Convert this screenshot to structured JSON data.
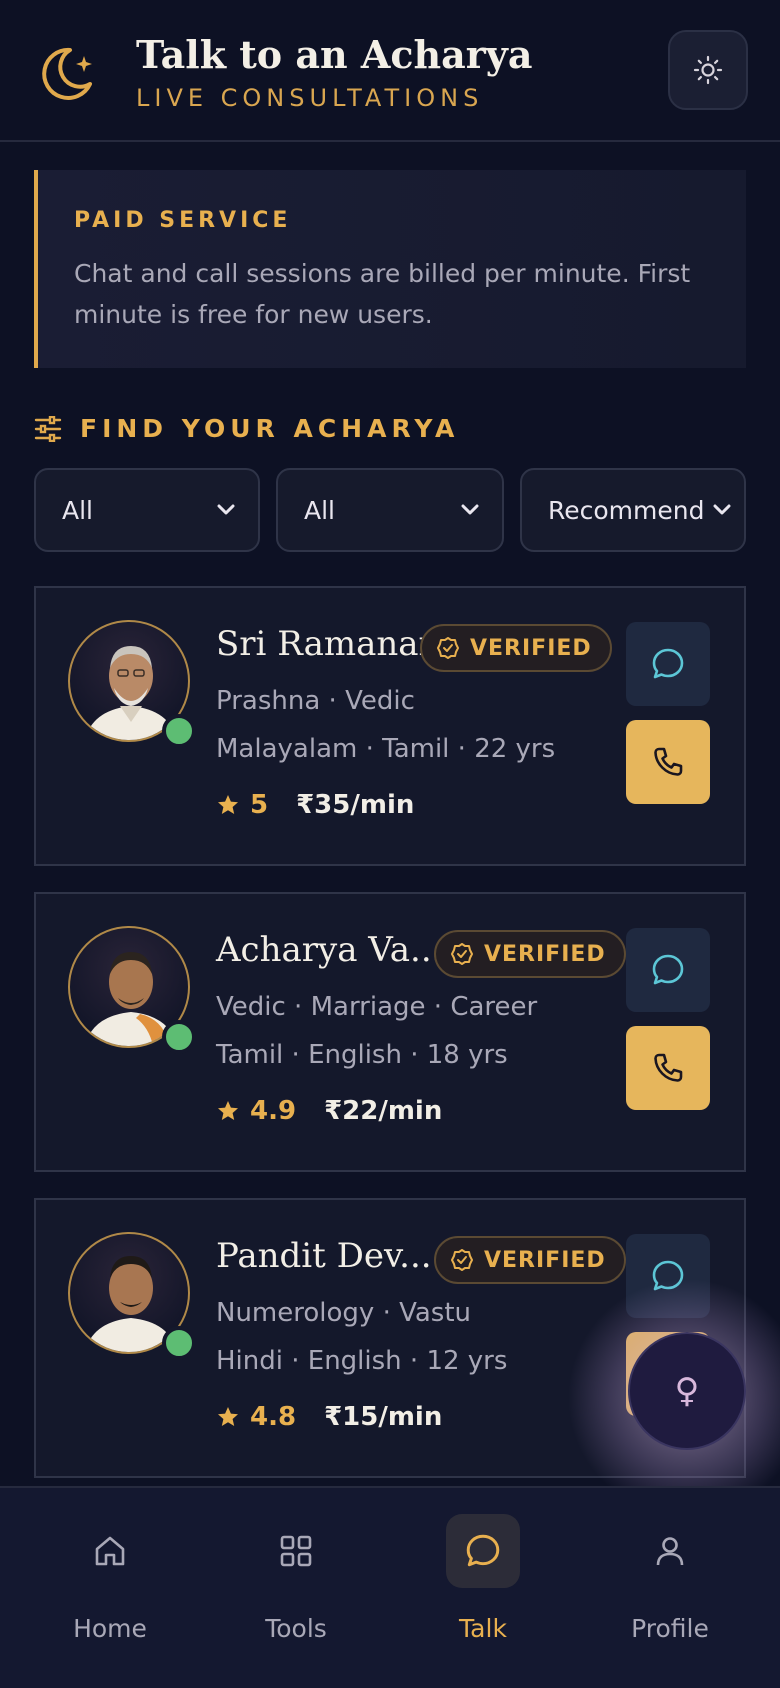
{
  "header": {
    "title": "Talk to an Acharya",
    "subtitle": "LIVE CONSULTATIONS",
    "logo_icon": "moon-star-icon",
    "theme_icon": "sun-icon"
  },
  "notice": {
    "title": "PAID SERVICE",
    "body": "Chat and call sessions are billed per minute. First minute is free for new users."
  },
  "filters": {
    "heading": "FIND YOUR ACHARYA",
    "icon": "sliders-icon",
    "selects": [
      {
        "value": "All"
      },
      {
        "value": "All"
      },
      {
        "value": "Recommend"
      }
    ]
  },
  "acharyas": [
    {
      "name": "Sri Ramanan",
      "badge": "VERIFIED",
      "specialties": "Prashna · Vedic",
      "languages": "Malayalam · Tamil · 22 yrs",
      "rating": "5",
      "price": "₹35/min",
      "online": true
    },
    {
      "name": "Acharya Va...",
      "badge": "VERIFIED",
      "specialties": "Vedic · Marriage · Career",
      "languages": "Tamil · English · 18 yrs",
      "rating": "4.9",
      "price": "₹22/min",
      "online": true
    },
    {
      "name": "Pandit Dev...",
      "badge": "VERIFIED",
      "specialties": "Numerology · Vastu",
      "languages": "Hindi · English · 12 yrs",
      "rating": "4.8",
      "price": "₹15/min",
      "online": true
    }
  ],
  "fab": {
    "icon": "venus-icon",
    "glyph": "♀"
  },
  "nav": [
    {
      "label": "Home",
      "icon": "home-icon",
      "active": false
    },
    {
      "label": "Tools",
      "icon": "grid-icon",
      "active": false
    },
    {
      "label": "Talk",
      "icon": "chat-icon",
      "active": true
    },
    {
      "label": "Profile",
      "icon": "user-icon",
      "active": false
    }
  ],
  "colors": {
    "background": "#0d1124",
    "accent": "#e8b04f",
    "online": "#5dbd73",
    "chat_icon": "#5cc6d6"
  }
}
